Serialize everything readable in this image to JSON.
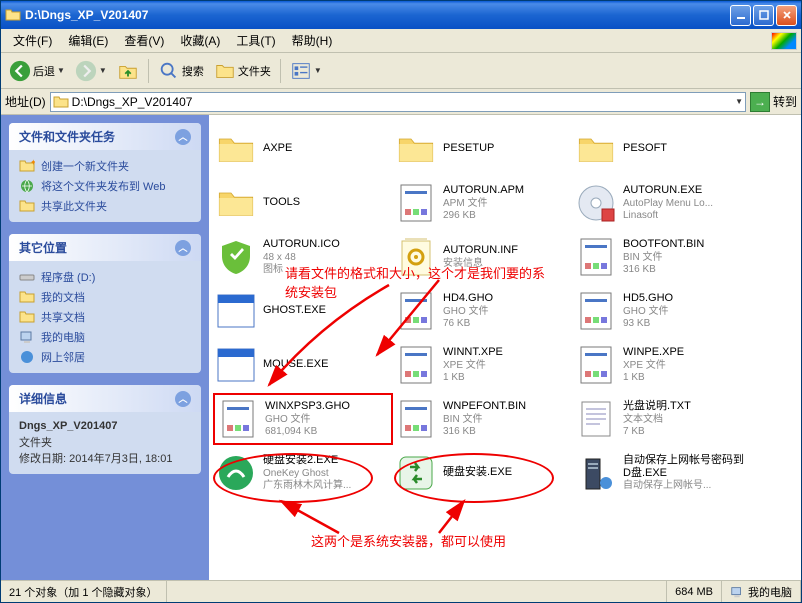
{
  "window": {
    "title": "D:\\Dngs_XP_V201407"
  },
  "menu": {
    "file": "文件(F)",
    "edit": "编辑(E)",
    "view": "查看(V)",
    "fav": "收藏(A)",
    "tools": "工具(T)",
    "help": "帮助(H)"
  },
  "toolbar": {
    "back": "后退",
    "search": "搜索",
    "folders": "文件夹"
  },
  "address": {
    "label": "地址(D)",
    "path": "D:\\Dngs_XP_V201407",
    "go": "转到"
  },
  "sidebar": {
    "tasks": {
      "title": "文件和文件夹任务",
      "items": [
        {
          "label": "创建一个新文件夹"
        },
        {
          "label": "将这个文件夹发布到 Web"
        },
        {
          "label": "共享此文件夹"
        }
      ]
    },
    "places": {
      "title": "其它位置",
      "items": [
        {
          "label": "程序盘 (D:)"
        },
        {
          "label": "我的文档"
        },
        {
          "label": "共享文档"
        },
        {
          "label": "我的电脑"
        },
        {
          "label": "网上邻居"
        }
      ]
    },
    "details": {
      "title": "详细信息",
      "name": "Dngs_XP_V201407",
      "type": "文件夹",
      "mod_label": "修改日期:",
      "mod_value": "2014年7月3日, 18:01"
    }
  },
  "files": [
    {
      "name": "AXPE",
      "icon": "folder"
    },
    {
      "name": "PESETUP",
      "icon": "folder"
    },
    {
      "name": "PESOFT",
      "icon": "folder"
    },
    {
      "name": "TOOLS",
      "icon": "folder"
    },
    {
      "name": "AUTORUN.APM",
      "meta1": "APM 文件",
      "meta2": "296 KB",
      "icon": "doc"
    },
    {
      "name": "AUTORUN.EXE",
      "meta1": "AutoPlay Menu Lo...",
      "meta2": "Linasoft",
      "icon": "cd"
    },
    {
      "name": "AUTORUN.ICO",
      "meta1": "48 x 48",
      "meta2": "图标",
      "icon": "shield"
    },
    {
      "name": "AUTORUN.INF",
      "meta1": "安装信息",
      "icon": "inf"
    },
    {
      "name": "BOOTFONT.BIN",
      "meta1": "BIN 文件",
      "meta2": "316 KB",
      "icon": "doc"
    },
    {
      "name": "GHOST.EXE",
      "icon": "exe"
    },
    {
      "name": "HD4.GHO",
      "meta1": "GHO 文件",
      "meta2": "76 KB",
      "icon": "doc"
    },
    {
      "name": "HD5.GHO",
      "meta1": "GHO 文件",
      "meta2": "93 KB",
      "icon": "doc"
    },
    {
      "name": "MOUSE.EXE",
      "icon": "exe"
    },
    {
      "name": "WINNT.XPE",
      "meta1": "XPE 文件",
      "meta2": "1 KB",
      "icon": "doc"
    },
    {
      "name": "WINPE.XPE",
      "meta1": "XPE 文件",
      "meta2": "1 KB",
      "icon": "doc"
    },
    {
      "name": "WINXPSP3.GHO",
      "meta1": "GHO 文件",
      "meta2": "681,094 KB",
      "icon": "doc",
      "highlight": true
    },
    {
      "name": "WNPEFONT.BIN",
      "meta1": "BIN 文件",
      "meta2": "316 KB",
      "icon": "doc"
    },
    {
      "name": "光盘说明.TXT",
      "meta1": "文本文档",
      "meta2": "7 KB",
      "icon": "txt"
    },
    {
      "name": "硬盘安装2.EXE",
      "meta1": "OneKey Ghost",
      "meta2": "广东雨林木风计算...",
      "icon": "green"
    },
    {
      "name": "硬盘安装.EXE",
      "icon": "green2"
    },
    {
      "name": "自动保存上网帐号密码到D盘.EXE",
      "meta1": "自动保存上网帐号...",
      "icon": "tower"
    }
  ],
  "annotations": {
    "a1": "请看文件的格式和大小，这个才是我们要的系统安装包",
    "a2": "这两个是系统安装器，都可以使用"
  },
  "status": {
    "left": "21 个对象（加 1 个隐藏对象）",
    "size": "684 MB",
    "location": "我的电脑"
  }
}
